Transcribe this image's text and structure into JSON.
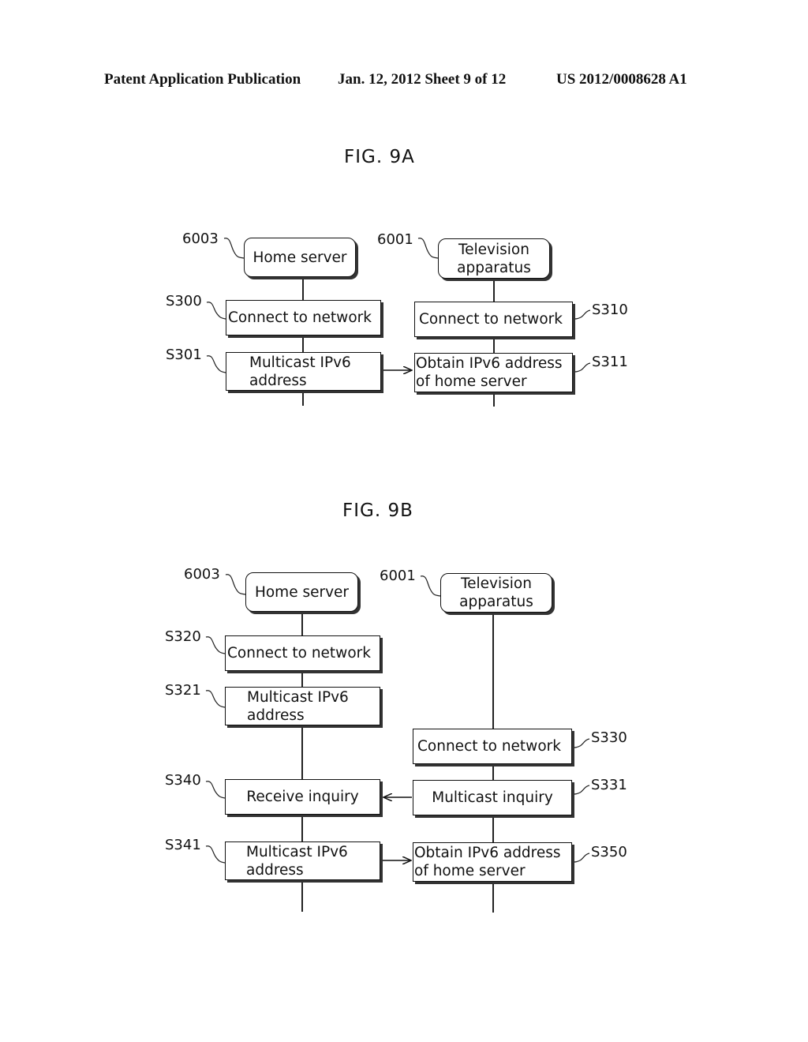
{
  "header": {
    "publication": "Patent Application Publication",
    "date_sheet": "Jan. 12, 2012  Sheet 9 of 12",
    "patent_number": "US 2012/0008628 A1"
  },
  "fig9a": {
    "title": "FIG. 9A",
    "home_server": {
      "ref": "6003",
      "label": "Home server"
    },
    "television": {
      "ref": "6001",
      "label_line1": "Television",
      "label_line2": "apparatus"
    },
    "steps": {
      "s300": {
        "ref": "S300",
        "line1": "Connect to network"
      },
      "s301": {
        "ref": "S301",
        "line1": "Multicast IPv6",
        "line2": "address"
      },
      "s310": {
        "ref": "S310",
        "line1": "Connect to network"
      },
      "s311": {
        "ref": "S311",
        "line1": "Obtain IPv6 address",
        "line2": "of home server"
      }
    }
  },
  "fig9b": {
    "title": "FIG. 9B",
    "home_server": {
      "ref": "6003",
      "label": "Home server"
    },
    "television": {
      "ref": "6001",
      "label_line1": "Television",
      "label_line2": "apparatus"
    },
    "steps": {
      "s320": {
        "ref": "S320",
        "line1": "Connect to network"
      },
      "s321": {
        "ref": "S321",
        "line1": "Multicast IPv6",
        "line2": "address"
      },
      "s330": {
        "ref": "S330",
        "line1": "Connect to network"
      },
      "s331": {
        "ref": "S331",
        "line1": "Multicast inquiry"
      },
      "s340": {
        "ref": "S340",
        "line1": "Receive inquiry"
      },
      "s341": {
        "ref": "S341",
        "line1": "Multicast IPv6",
        "line2": "address"
      },
      "s350": {
        "ref": "S350",
        "line1": "Obtain IPv6 address",
        "line2": "of home server"
      }
    }
  }
}
